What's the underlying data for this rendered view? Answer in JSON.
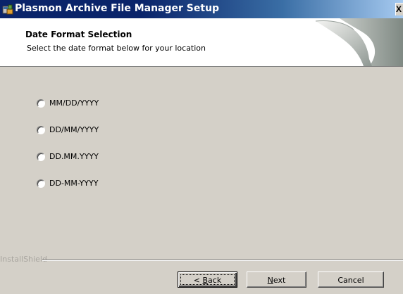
{
  "window": {
    "title": "Plasmon Archive File Manager Setup",
    "close_glyph": "X",
    "title_icon": "setup-icon"
  },
  "banner": {
    "title": "Date Format Selection",
    "subtitle": "Select the date format below for your location"
  },
  "date_formats": [
    {
      "label": "MM/DD/YYYY",
      "selected": false
    },
    {
      "label": "DD/MM/YYYY",
      "selected": false
    },
    {
      "label": "DD.MM.YYYY",
      "selected": false
    },
    {
      "label": "DD-MM-YYYY",
      "selected": false
    }
  ],
  "footer": {
    "brand": "InstallShield",
    "back_prefix": "< ",
    "back_mnemonic": "B",
    "back_rest": "ack",
    "next_mnemonic": "N",
    "next_rest": "ext",
    "cancel_label": "Cancel"
  },
  "colors": {
    "dialog_bg": "#d4d0c8",
    "titlebar_active": "#0a246a",
    "banner_bg": "#ffffff"
  }
}
